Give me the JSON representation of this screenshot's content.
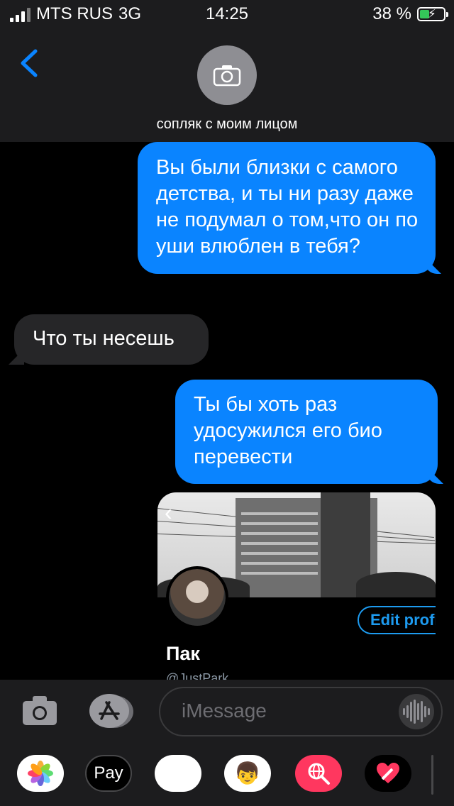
{
  "status_bar": {
    "carrier": "MTS RUS",
    "network": "3G",
    "time": "14:25",
    "battery": "38 %",
    "battery_level": 0.38
  },
  "header": {
    "contact_name": "сопляк с моим лицом"
  },
  "messages": [
    {
      "direction": "outgoing",
      "text": "Вы были близки с самого детства, и ты ни разу даже не подумал о том,что он по уши влюблен в тебя?"
    },
    {
      "direction": "incoming",
      "text": "Что ты несешь"
    },
    {
      "direction": "outgoing",
      "text": "Ты бы хоть раз удосужился  его био перевести"
    }
  ],
  "attachment": {
    "edit_label": "Edit profi",
    "profile_name": "Пак",
    "profile_handle": "@JustPark"
  },
  "composer": {
    "placeholder": "iMessage"
  },
  "app_tray": {
    "apps": [
      "photos-app",
      "apple-pay-app",
      "animoji-app",
      "memoji-app",
      "web-images-app",
      "digital-touch-app"
    ],
    "apple_pay_label": "Pay"
  },
  "colors": {
    "outgoing_bubble": "#0a84ff",
    "incoming_bubble": "#262628",
    "accent": "#0a84ff"
  }
}
